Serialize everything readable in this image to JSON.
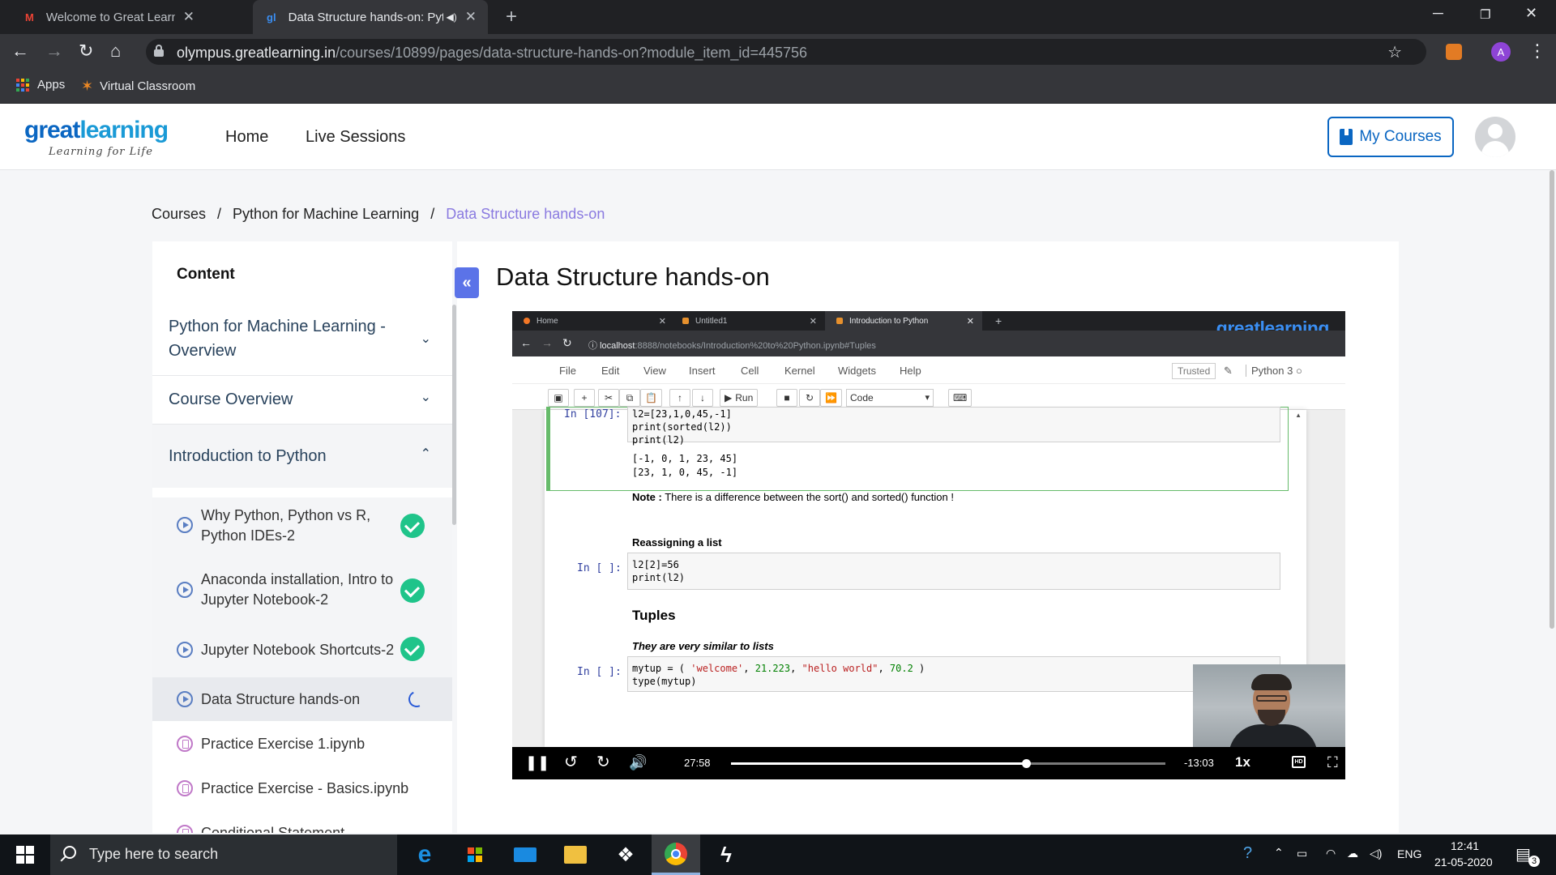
{
  "browser": {
    "tabs": [
      {
        "title": "Welcome to Great Learning Acad",
        "favicon": "gmail-icon",
        "active": false
      },
      {
        "title": "Data Structure hands-on: Pyt",
        "favicon": "greatlearning-icon",
        "active": true
      }
    ],
    "new_tab": "+",
    "url_host": "olympus.greatlearning.in",
    "url_path": "/courses/10899/pages/data-structure-hands-on?module_item_id=445756",
    "bookmarks": [
      {
        "label": "Apps",
        "icon": "apps-grid-icon"
      },
      {
        "label": "Virtual Classroom",
        "icon": "virtual-classroom-icon"
      }
    ],
    "profile_initial": "A"
  },
  "site": {
    "logo_part1": "great",
    "logo_part2": "learning",
    "logo_tagline": "Learning for Life",
    "nav": [
      "Home",
      "Live Sessions"
    ],
    "my_courses": "My Courses",
    "brand_color": "#0a66c2"
  },
  "breadcrumb": {
    "items": [
      "Courses",
      "Python for Machine Learning",
      "Data Structure hands-on"
    ],
    "separator": "/"
  },
  "sidebar": {
    "title": "Content",
    "sections": [
      {
        "label": "Python for Machine Learning - Overview",
        "expanded": false
      },
      {
        "label": "Course Overview",
        "expanded": false
      },
      {
        "label": "Introduction to Python",
        "expanded": true
      }
    ],
    "lessons": [
      {
        "label": "Why Python, Python vs R, Python IDEs-2",
        "type": "video",
        "status": "completed"
      },
      {
        "label": "Anaconda installation, Intro to Jupyter Notebook-2",
        "type": "video",
        "status": "completed"
      },
      {
        "label": "Jupyter Notebook Shortcuts-2",
        "type": "video",
        "status": "completed"
      },
      {
        "label": "Data Structure hands-on",
        "type": "video",
        "status": "in-progress"
      },
      {
        "label": "Practice Exercise 1.ipynb",
        "type": "notebook",
        "status": "none"
      },
      {
        "label": "Practice Exercise - Basics.ipynb",
        "type": "notebook",
        "status": "none"
      },
      {
        "label": "Conditional Statement",
        "type": "notebook",
        "status": "none"
      }
    ],
    "collapse_glyph": "«"
  },
  "main": {
    "title": "Data Structure hands-on"
  },
  "video": {
    "inner_tabs": [
      "Home",
      "Untitled1",
      "Introduction to Python"
    ],
    "inner_logo": "greatlearning",
    "inner_url_host": "localhost",
    "inner_url_rest": ":8888/notebooks/Introduction%20to%20Python.ipynb#Tuples",
    "jupyter_menu": [
      "File",
      "Edit",
      "View",
      "Insert",
      "Cell",
      "Kernel",
      "Widgets",
      "Help"
    ],
    "trusted": "Trusted",
    "kernel": "Python 3",
    "run_label": "Run",
    "cell_type": "Code",
    "cells": {
      "prompt1": "In [107]:",
      "code1": [
        "l2=[23,1,0,45,-1]",
        "print(sorted(l2))",
        "print(l2)"
      ],
      "output1": [
        "[-1, 0, 1, 23, 45]",
        "[23, 1, 0, 45, -1]"
      ],
      "note_bold": "Note :",
      "note_text": " There is a difference between the sort() and sorted() function !",
      "heading_reassign": "Reassigning a list",
      "prompt2": "In [ ]:",
      "code2": [
        "l2[2]=56",
        "print(l2)"
      ],
      "heading_tuples": "Tuples",
      "tuples_desc": "They are very similar to lists",
      "prompt3": "In [ ]:",
      "code3_a": "mytup = ( ",
      "code3_s1": "'welcome'",
      "code3_c1": ", ",
      "code3_n1": "21.223",
      "code3_c2": ", ",
      "code3_s2": "\"hello world\"",
      "code3_c3": ", ",
      "code3_n2": "70.2",
      "code3_end": "  )",
      "code3_b": "type(mytup)"
    },
    "time_current": "27:58",
    "time_remaining": "-13:03",
    "progress_fraction": 0.68,
    "speed": "1x",
    "hd_label": "HD"
  },
  "taskbar": {
    "search_placeholder": "Type here to search",
    "language": "ENG",
    "time": "12:41",
    "date": "21-05-2020",
    "notifications": "3"
  }
}
